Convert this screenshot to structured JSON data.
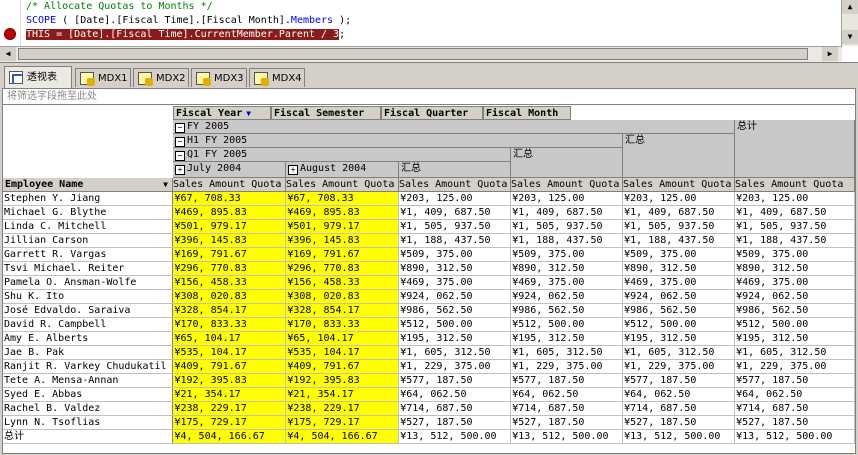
{
  "editor": {
    "lines": [
      {
        "parts": [
          {
            "t": "/* Allocate Quotas to Months */",
            "c": "cmt"
          }
        ]
      },
      {
        "parts": [
          {
            "t": "SCOPE",
            "c": "kw"
          },
          {
            "t": " ( [Date].[Fiscal Time].[Fiscal Month].",
            "c": ""
          },
          {
            "t": "Members",
            "c": "kw"
          },
          {
            "t": " );",
            "c": ""
          }
        ]
      },
      {
        "parts": [
          {
            "t": "THIS = [Date].[Fiscal Time].CurrentMember.Parent / 3",
            "c": "hl"
          },
          {
            "t": ";",
            "c": ""
          }
        ]
      }
    ]
  },
  "tabs": [
    {
      "label": "透视表",
      "icon": "pivot-table-icon"
    },
    {
      "label": "MDX1",
      "icon": "mdx-script-icon"
    },
    {
      "label": "MDX2",
      "icon": "mdx-script-icon"
    },
    {
      "label": "MDX3",
      "icon": "mdx-script-icon"
    },
    {
      "label": "MDX4",
      "icon": "mdx-script-icon"
    }
  ],
  "filter_placeholder": "将筛选字段拖至此处",
  "column_fields": [
    {
      "label": "Fiscal Year",
      "has_filter": true
    },
    {
      "label": "Fiscal Semester",
      "has_filter": false
    },
    {
      "label": "Fiscal Quarter",
      "has_filter": false
    },
    {
      "label": "Fiscal Month",
      "has_filter": false
    }
  ],
  "col_headers": {
    "year": "FY 2005",
    "semester": "H1 FY 2005",
    "quarter": "Q1 FY 2005",
    "months": [
      "July 2004",
      "August 2004"
    ],
    "subtotal": "汇总",
    "grand_total": "总计",
    "measure": "Sales Amount Quota"
  },
  "row_field": "Employee Name",
  "rows": [
    {
      "name": "Stephen Y. Jiang",
      "v": [
        "¥67, 708.33",
        "¥67, 708.33",
        "¥203, 125.00",
        "¥203, 125.00",
        "¥203, 125.00",
        "¥203, 125.00"
      ]
    },
    {
      "name": "Michael G. Blythe",
      "v": [
        "¥469, 895.83",
        "¥469, 895.83",
        "¥1, 409, 687.50",
        "¥1, 409, 687.50",
        "¥1, 409, 687.50",
        "¥1, 409, 687.50"
      ]
    },
    {
      "name": "Linda C. Mitchell",
      "v": [
        "¥501, 979.17",
        "¥501, 979.17",
        "¥1, 505, 937.50",
        "¥1, 505, 937.50",
        "¥1, 505, 937.50",
        "¥1, 505, 937.50"
      ]
    },
    {
      "name": "Jillian Carson",
      "v": [
        "¥396, 145.83",
        "¥396, 145.83",
        "¥1, 188, 437.50",
        "¥1, 188, 437.50",
        "¥1, 188, 437.50",
        "¥1, 188, 437.50"
      ]
    },
    {
      "name": "Garrett R. Vargas",
      "v": [
        "¥169, 791.67",
        "¥169, 791.67",
        "¥509, 375.00",
        "¥509, 375.00",
        "¥509, 375.00",
        "¥509, 375.00"
      ]
    },
    {
      "name": "Tsvi Michael. Reiter",
      "v": [
        "¥296, 770.83",
        "¥296, 770.83",
        "¥890, 312.50",
        "¥890, 312.50",
        "¥890, 312.50",
        "¥890, 312.50"
      ]
    },
    {
      "name": "Pamela O. Ansman-Wolfe",
      "v": [
        "¥156, 458.33",
        "¥156, 458.33",
        "¥469, 375.00",
        "¥469, 375.00",
        "¥469, 375.00",
        "¥469, 375.00"
      ]
    },
    {
      "name": "Shu K. Ito",
      "v": [
        "¥308, 020.83",
        "¥308, 020.83",
        "¥924, 062.50",
        "¥924, 062.50",
        "¥924, 062.50",
        "¥924, 062.50"
      ]
    },
    {
      "name": "José Edvaldo. Saraiva",
      "v": [
        "¥328, 854.17",
        "¥328, 854.17",
        "¥986, 562.50",
        "¥986, 562.50",
        "¥986, 562.50",
        "¥986, 562.50"
      ]
    },
    {
      "name": "David R. Campbell",
      "v": [
        "¥170, 833.33",
        "¥170, 833.33",
        "¥512, 500.00",
        "¥512, 500.00",
        "¥512, 500.00",
        "¥512, 500.00"
      ]
    },
    {
      "name": "Amy E. Alberts",
      "v": [
        "¥65, 104.17",
        "¥65, 104.17",
        "¥195, 312.50",
        "¥195, 312.50",
        "¥195, 312.50",
        "¥195, 312.50"
      ]
    },
    {
      "name": "Jae B. Pak",
      "v": [
        "¥535, 104.17",
        "¥535, 104.17",
        "¥1, 605, 312.50",
        "¥1, 605, 312.50",
        "¥1, 605, 312.50",
        "¥1, 605, 312.50"
      ]
    },
    {
      "name": "Ranjit R. Varkey Chudukatil",
      "v": [
        "¥409, 791.67",
        "¥409, 791.67",
        "¥1, 229, 375.00",
        "¥1, 229, 375.00",
        "¥1, 229, 375.00",
        "¥1, 229, 375.00"
      ]
    },
    {
      "name": "Tete A. Mensa-Annan",
      "v": [
        "¥192, 395.83",
        "¥192, 395.83",
        "¥577, 187.50",
        "¥577, 187.50",
        "¥577, 187.50",
        "¥577, 187.50"
      ]
    },
    {
      "name": "Syed E. Abbas",
      "v": [
        "¥21, 354.17",
        "¥21, 354.17",
        "¥64, 062.50",
        "¥64, 062.50",
        "¥64, 062.50",
        "¥64, 062.50"
      ]
    },
    {
      "name": "Rachel B. Valdez",
      "v": [
        "¥238, 229.17",
        "¥238, 229.17",
        "¥714, 687.50",
        "¥714, 687.50",
        "¥714, 687.50",
        "¥714, 687.50"
      ]
    },
    {
      "name": "Lynn N. Tsoflias",
      "v": [
        "¥175, 729.17",
        "¥175, 729.17",
        "¥527, 187.50",
        "¥527, 187.50",
        "¥527, 187.50",
        "¥527, 187.50"
      ]
    },
    {
      "name": "总计",
      "v": [
        "¥4, 504, 166.67",
        "¥4, 504, 166.67",
        "¥13, 512, 500.00",
        "¥13, 512, 500.00",
        "¥13, 512, 500.00",
        "¥13, 512, 500.00"
      ]
    }
  ],
  "colors": {
    "highlight_cells": "#ffff00",
    "header_gray": "#c8c8c8",
    "breakpoint": "#c00000",
    "selection": "#8b1a1a"
  }
}
